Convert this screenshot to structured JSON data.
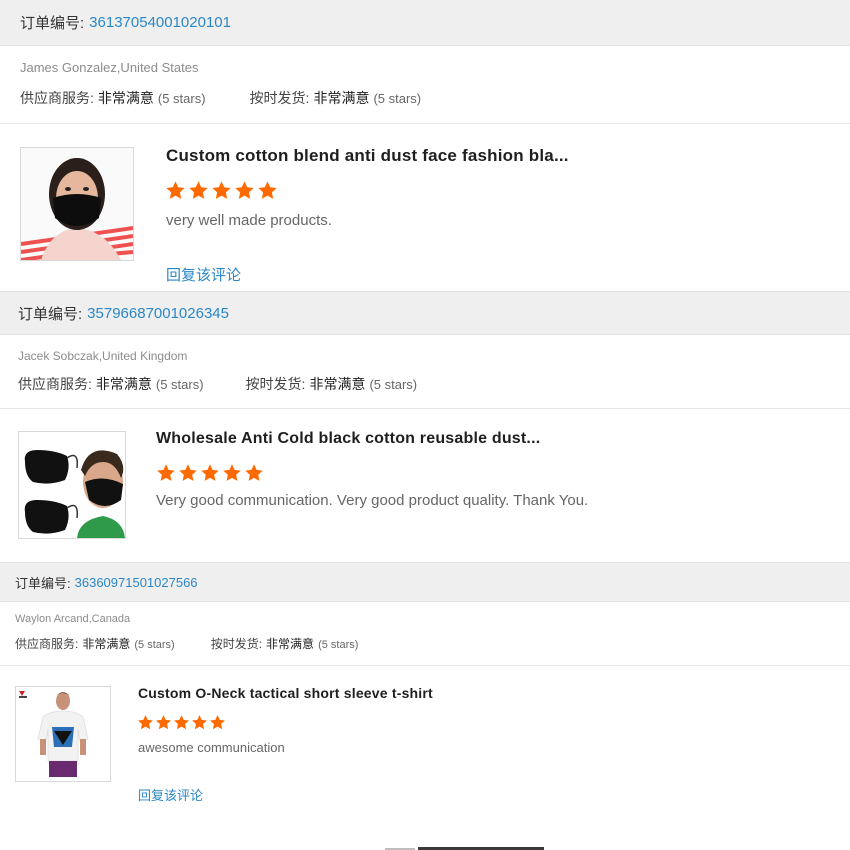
{
  "order_label": "订单编号:",
  "reviews": [
    {
      "order_number": "36137054001020101",
      "buyer": "James Gonzalez,United States",
      "supplier_service_label": "供应商服务:",
      "supplier_service_value": "非常满意",
      "supplier_service_stars": "(5 stars)",
      "ontime_label": "按时发货:",
      "ontime_value": "非常满意",
      "ontime_stars": "(5 stars)",
      "product_title": "Custom cotton blend anti dust face fashion bla...",
      "rating": 5,
      "comment": "very well made products.",
      "reply_label": "回复该评论"
    },
    {
      "order_number": "35796687001026345",
      "buyer": "Jacek Sobczak,United Kingdom",
      "supplier_service_label": "供应商服务:",
      "supplier_service_value": "非常满意",
      "supplier_service_stars": "(5 stars)",
      "ontime_label": "按时发货:",
      "ontime_value": "非常满意",
      "ontime_stars": "(5 stars)",
      "product_title": "Wholesale Anti Cold black cotton reusable dust...",
      "rating": 5,
      "comment": "Very good communication. Very good product quality. Thank You."
    },
    {
      "order_number": "36360971501027566",
      "buyer": "Waylon Arcand,Canada",
      "supplier_service_label": "供应商服务:",
      "supplier_service_value": "非常满意",
      "supplier_service_stars": "(5 stars)",
      "ontime_label": "按时发货:",
      "ontime_value": "非常满意",
      "ontime_stars": "(5 stars)",
      "product_title": "Custom O-Neck tactical short sleeve t-shirt",
      "rating": 5,
      "comment": "awesome communication",
      "reply_label": "回复该评论"
    }
  ],
  "colors": {
    "star": "#ff6a00",
    "link": "#2a87c7",
    "header_bg": "#efefef"
  },
  "icons": [
    "star-icon"
  ]
}
